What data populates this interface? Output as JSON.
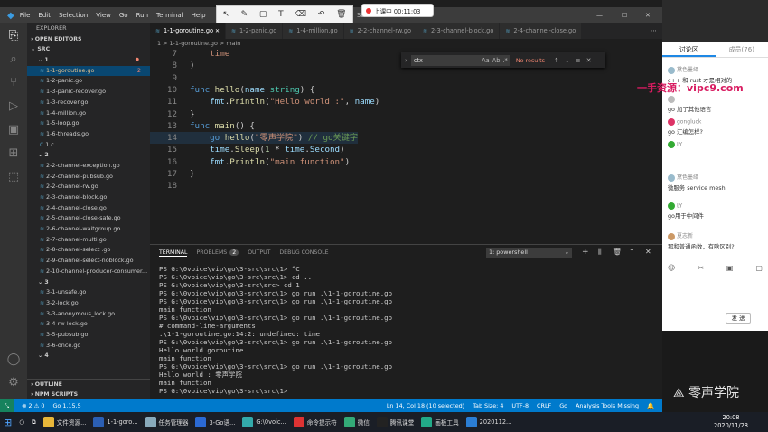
{
  "window": {
    "title": "Studio Code"
  },
  "menu": [
    "File",
    "Edit",
    "Selection",
    "View",
    "Go",
    "Run",
    "Terminal",
    "Help"
  ],
  "recording": {
    "label": "上课中 00:11:03"
  },
  "sidebar": {
    "explorer_title": "EXPLORER",
    "open_editors": "OPEN EDITORS",
    "src": "SRC",
    "rows": [
      {
        "label": "1",
        "type": "folder",
        "dot": true
      },
      {
        "label": "1-1-goroutine.go",
        "type": "file",
        "selected": true,
        "badge": "2"
      },
      {
        "label": "1-2-panic.go",
        "type": "file"
      },
      {
        "label": "1-3-panic-recover.go",
        "type": "file"
      },
      {
        "label": "1-3-recover.go",
        "type": "file"
      },
      {
        "label": "1-4-million.go",
        "type": "file"
      },
      {
        "label": "1-5-loop.go",
        "type": "file"
      },
      {
        "label": "1-6-threads.go",
        "type": "file"
      },
      {
        "label": "1.c",
        "type": "file"
      },
      {
        "label": "2",
        "type": "folder"
      },
      {
        "label": "2-2-channel-exception.go",
        "type": "file"
      },
      {
        "label": "2-2-channel-pubsub.go",
        "type": "file"
      },
      {
        "label": "2-2-channel-rw.go",
        "type": "file"
      },
      {
        "label": "2-3-channel-block.go",
        "type": "file"
      },
      {
        "label": "2-4-channel-close.go",
        "type": "file"
      },
      {
        "label": "2-5-channel-close-safe.go",
        "type": "file"
      },
      {
        "label": "2-6-channel-waitgroup.go",
        "type": "file"
      },
      {
        "label": "2-7-channel-multi.go",
        "type": "file"
      },
      {
        "label": "2-8-channel-select .go",
        "type": "file"
      },
      {
        "label": "2-9-channel-select-noblock.go",
        "type": "file"
      },
      {
        "label": "2-10-channel-producer-consumer...",
        "type": "file"
      },
      {
        "label": "3",
        "type": "folder"
      },
      {
        "label": "3-1-unsafe.go",
        "type": "file"
      },
      {
        "label": "3-2-lock.go",
        "type": "file"
      },
      {
        "label": "3-3-anonymous_lock.go",
        "type": "file"
      },
      {
        "label": "3-4-rw-lock.go",
        "type": "file"
      },
      {
        "label": "3-5-pubsub.go",
        "type": "file"
      },
      {
        "label": "3-6-once.go",
        "type": "file"
      },
      {
        "label": "4",
        "type": "folder"
      }
    ],
    "outline": "OUTLINE",
    "npm": "NPM SCRIPTS"
  },
  "tabs": [
    "1-1-goroutine.go",
    "1-2-panic.go",
    "1-4-million.go",
    "2-2-channel-rw.go",
    "2-3-channel-block.go",
    "2-4-channel-close.go"
  ],
  "breadcrumb": "1 > 1-1-goroutine.go > main",
  "find": {
    "value": "ctx",
    "result": "No results",
    "aa": "Aa",
    "ab": "Ab",
    "re": ".*"
  },
  "code": [
    {
      "n": "7",
      "html": [
        [
          "",
          "    "
        ],
        [
          "str",
          "time"
        ]
      ]
    },
    {
      "n": "8",
      "html": [
        [
          "",
          ")"
        ]
      ]
    },
    {
      "n": "9",
      "html": [
        [
          "",
          ""
        ]
      ]
    },
    {
      "n": "10",
      "html": [
        [
          "kw",
          "func "
        ],
        [
          "fn",
          "hello"
        ],
        [
          "",
          "("
        ],
        [
          "id",
          "name "
        ],
        [
          "ty",
          "string"
        ],
        [
          "",
          ") {"
        ]
      ]
    },
    {
      "n": "11",
      "html": [
        [
          "",
          "    "
        ],
        [
          "id",
          "fmt"
        ],
        [
          "",
          "."
        ],
        [
          "fn",
          "Println"
        ],
        [
          "",
          "("
        ],
        [
          "str",
          "\"Hello world :\""
        ],
        [
          "",
          ", "
        ],
        [
          "id",
          "name"
        ],
        [
          "",
          ")"
        ]
      ]
    },
    {
      "n": "12",
      "html": [
        [
          "",
          "}"
        ]
      ]
    },
    {
      "n": "13",
      "html": [
        [
          "kw",
          "func "
        ],
        [
          "fn",
          "main"
        ],
        [
          "",
          "() {"
        ]
      ]
    },
    {
      "n": "14",
      "html": [
        [
          "",
          "    "
        ],
        [
          "kw",
          "go "
        ],
        [
          "fn",
          "hello"
        ],
        [
          "",
          "("
        ],
        [
          "str",
          "\"零声学院\""
        ],
        [
          "",
          ")"
        ],
        [
          "cm",
          " // go关键字"
        ]
      ]
    },
    {
      "n": "15",
      "html": [
        [
          "",
          "    "
        ],
        [
          "id",
          "time"
        ],
        [
          "",
          "."
        ],
        [
          "fn",
          "Sleep"
        ],
        [
          "",
          "("
        ],
        [
          "num",
          "1"
        ],
        [
          "",
          " * "
        ],
        [
          "id",
          "time"
        ],
        [
          "",
          "."
        ],
        [
          "id",
          "Second"
        ],
        [
          "",
          ")"
        ]
      ]
    },
    {
      "n": "16",
      "html": [
        [
          "",
          "    "
        ],
        [
          "id",
          "fmt"
        ],
        [
          "",
          "."
        ],
        [
          "fn",
          "Println"
        ],
        [
          "",
          "("
        ],
        [
          "str",
          "\"main function\""
        ],
        [
          "",
          ")"
        ]
      ]
    },
    {
      "n": "17",
      "html": [
        [
          "",
          "}"
        ]
      ]
    },
    {
      "n": "18",
      "html": [
        [
          "",
          ""
        ]
      ]
    }
  ],
  "panel": {
    "tabs": [
      "TERMINAL",
      "PROBLEMS",
      "OUTPUT",
      "DEBUG CONSOLE"
    ],
    "problems_count": "2",
    "shell": "1: powershell",
    "lines": [
      "PS G:\\0voice\\vip\\go\\3-src\\src\\1> ^C",
      "PS G:\\0voice\\vip\\go\\3-src\\src\\1> cd ..",
      "PS G:\\0voice\\vip\\go\\3-src\\src> cd 1",
      "PS G:\\0voice\\vip\\go\\3-src\\src\\1> go run .\\1-1-goroutine.go",
      "PS G:\\0voice\\vip\\go\\3-src\\src\\1> go run .\\1-1-goroutine.go",
      "main function",
      "PS G:\\0voice\\vip\\go\\3-src\\src\\1> go run .\\1-1-goroutine.go",
      "# command-line-arguments",
      ".\\1-1-goroutine.go:14:2: undefined: time",
      "PS G:\\0voice\\vip\\go\\3-src\\src\\1> go run .\\1-1-goroutine.go",
      "Hello world goroutine",
      "main function",
      "PS G:\\0voice\\vip\\go\\3-src\\src\\1> go run .\\1-1-goroutine.go",
      "Hello world : 零声学院",
      "main function",
      "PS G:\\0voice\\vip\\go\\3-src\\src\\1> "
    ]
  },
  "status": {
    "left": [
      "⊗ 2 ⚠ 0",
      "Go 1.15.5"
    ],
    "right": [
      "Ln 14, Col 18 (10 selected)",
      "Tab Size: 4",
      "UTF-8",
      "CRLF",
      "Go",
      "Analysis Tools Missing"
    ]
  },
  "chat": {
    "tab_discuss": "讨论区",
    "tab_members": "成员(76)",
    "messages": [
      {
        "name": "黛色墨绎",
        "text": "c++ 和 rust 才是相对的"
      },
      {
        "name": "",
        "text": "go 加了其他语言"
      },
      {
        "name": "gongluck",
        "text": "go 汇编怎样?"
      },
      {
        "name": "LY",
        "text": ""
      },
      {
        "name": "黛色墨绎",
        "text": "微服务 service mesh"
      },
      {
        "name": "LY",
        "text": "go用于中间件"
      },
      {
        "name": "夏志新",
        "text": "那和普通函数，有啥区别?"
      }
    ],
    "send": "发 送",
    "brand": "零声学院"
  },
  "watermark": "一手资源：vipc9.com",
  "taskbar": {
    "items": [
      "文件资源...",
      "1-1-goro...",
      "任务管理器",
      "3-Go语...",
      "G:\\0voic...",
      "命令提示符",
      "微信",
      "腾讯课堂",
      "画板工具",
      "2020112..."
    ],
    "time": "20:08",
    "date": "2020/11/28"
  }
}
